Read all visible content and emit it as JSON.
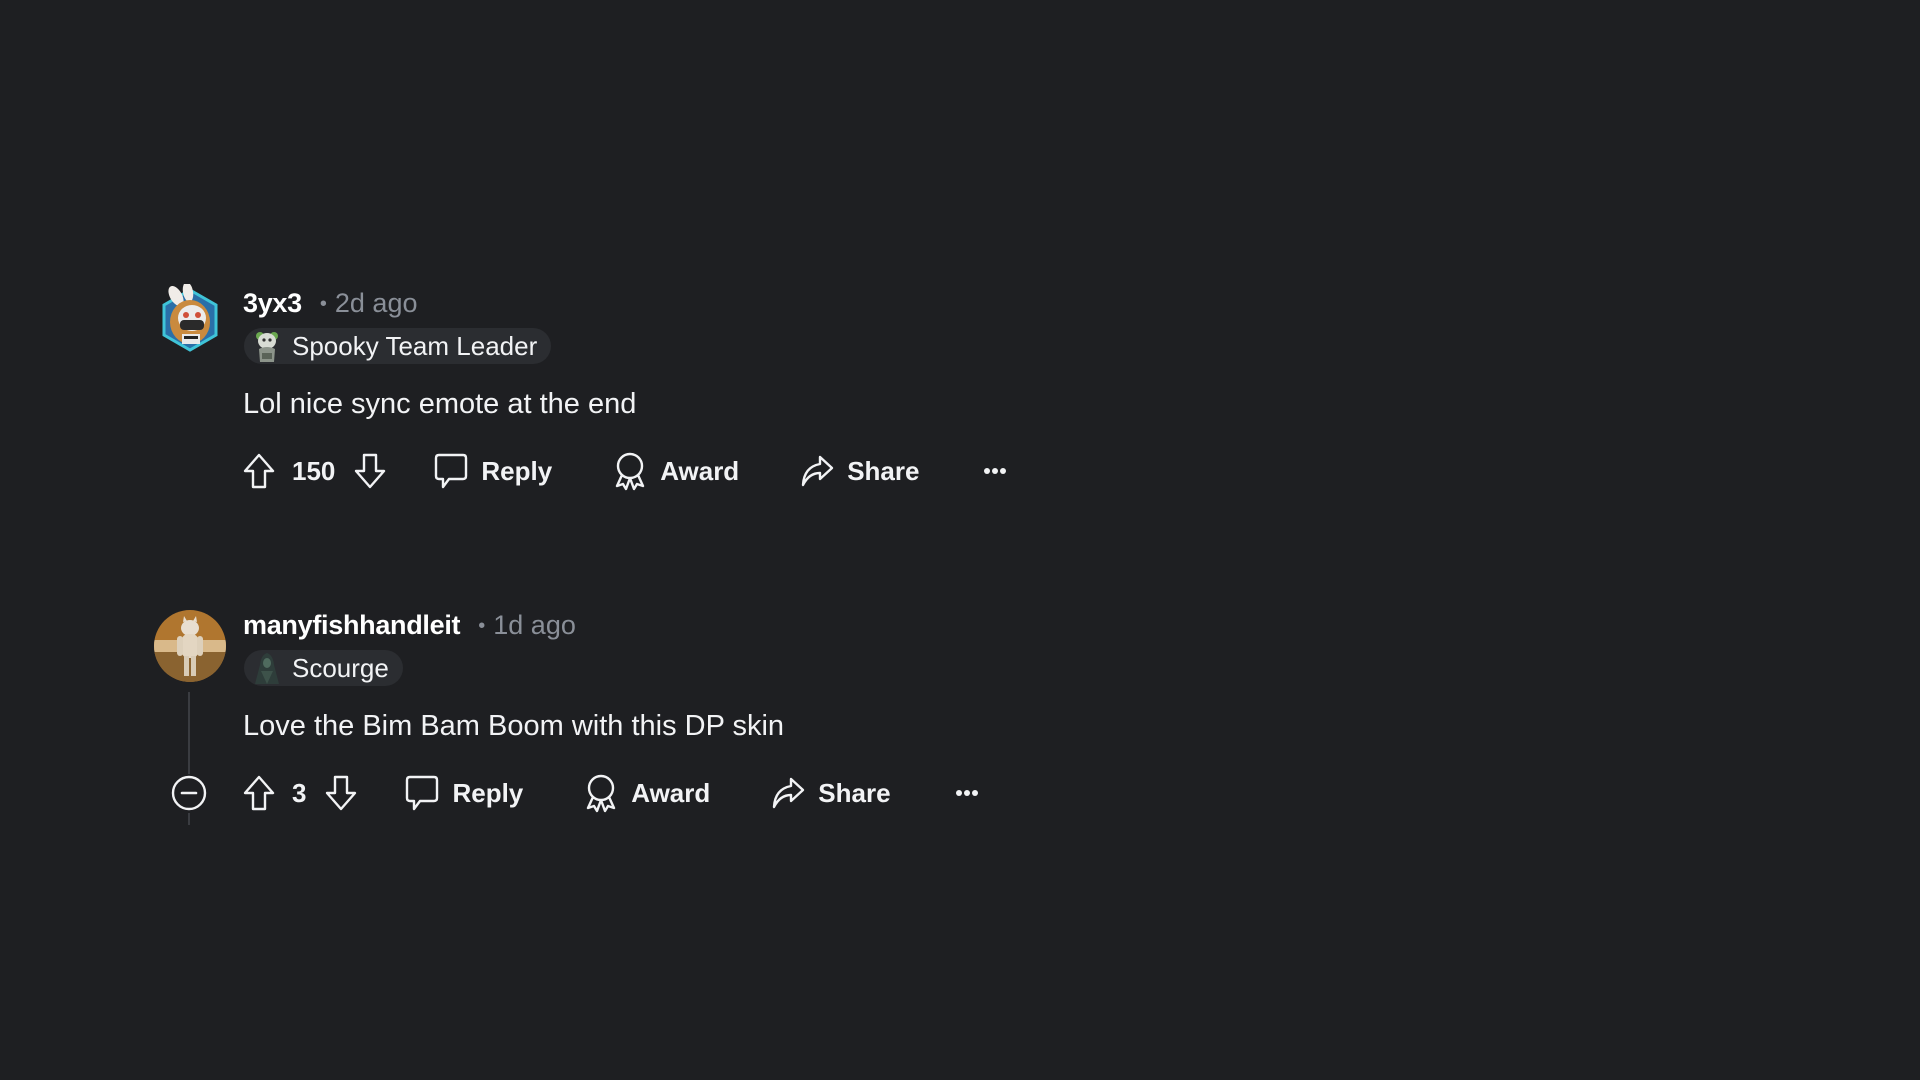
{
  "comments": [
    {
      "username": "3yx3",
      "separator": "•",
      "timestamp": "2d ago",
      "avatar": "bunny-hood-character-avatar",
      "flair": {
        "icon": "ghost-bear-flair-icon",
        "label": "Spooky Team Leader"
      },
      "body": "Lol nice sync emote at the end",
      "votes": "150",
      "actions": {
        "reply": "Reply",
        "award": "Award",
        "share": "Share",
        "more": "more-options-icon"
      },
      "collapsible": false
    },
    {
      "username": "manyfishhandleit",
      "separator": "•",
      "timestamp": "1d ago",
      "avatar": "standing-cat-avatar",
      "flair": {
        "icon": "hooded-figure-flair-icon",
        "label": "Scourge"
      },
      "body": "Love the Bim Bam Boom with this DP skin",
      "votes": "3",
      "actions": {
        "reply": "Reply",
        "award": "Award",
        "share": "Share",
        "more": "more-options-icon"
      },
      "collapsible": true
    }
  ],
  "colors": {
    "background": "#1e1f22",
    "text": "#f2f3f5",
    "muted": "#8a8f98",
    "flair_bg": "#2b2d31",
    "thread_line": "#3a3c41"
  }
}
